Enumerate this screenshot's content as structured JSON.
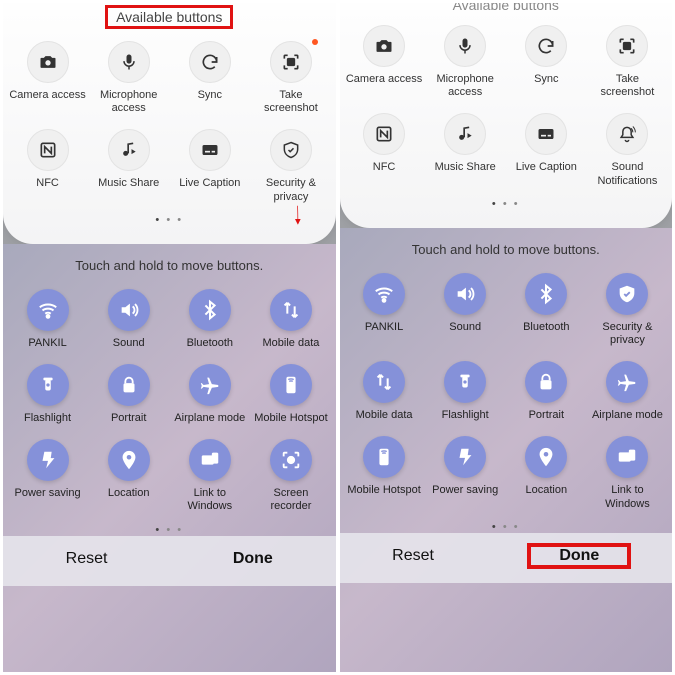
{
  "left": {
    "header": "Available buttons",
    "hint": "Touch and hold to move buttons.",
    "available": [
      {
        "label": "Camera access",
        "icon": "camera"
      },
      {
        "label": "Microphone access",
        "icon": "mic"
      },
      {
        "label": "Sync",
        "icon": "sync"
      },
      {
        "label": "Take screenshot",
        "icon": "screenshot",
        "dot": true
      },
      {
        "label": "NFC",
        "icon": "nfc"
      },
      {
        "label": "Music Share",
        "icon": "music"
      },
      {
        "label": "Live Caption",
        "icon": "caption"
      },
      {
        "label": "Security & privacy",
        "icon": "shield"
      }
    ],
    "active": [
      {
        "label": "PANKIL",
        "icon": "wifi"
      },
      {
        "label": "Sound",
        "icon": "sound"
      },
      {
        "label": "Bluetooth",
        "icon": "bt"
      },
      {
        "label": "Mobile data",
        "icon": "data"
      },
      {
        "label": "Flashlight",
        "icon": "flash"
      },
      {
        "label": "Portrait",
        "icon": "lock"
      },
      {
        "label": "Airplane mode",
        "icon": "plane"
      },
      {
        "label": "Mobile Hotspot",
        "icon": "hotspot"
      },
      {
        "label": "Power saving",
        "icon": "power"
      },
      {
        "label": "Location",
        "icon": "loc"
      },
      {
        "label": "Link to Windows",
        "icon": "link"
      },
      {
        "label": "Screen recorder",
        "icon": "rec"
      }
    ],
    "reset": "Reset",
    "done": "Done"
  },
  "right": {
    "header": "Available buttons",
    "hint": "Touch and hold to move buttons.",
    "available": [
      {
        "label": "Camera access",
        "icon": "camera"
      },
      {
        "label": "Microphone access",
        "icon": "mic"
      },
      {
        "label": "Sync",
        "icon": "sync"
      },
      {
        "label": "Take screenshot",
        "icon": "screenshot"
      },
      {
        "label": "NFC",
        "icon": "nfc"
      },
      {
        "label": "Music Share",
        "icon": "music"
      },
      {
        "label": "Live Caption",
        "icon": "caption"
      },
      {
        "label": "Sound Notifications",
        "icon": "bell"
      }
    ],
    "active": [
      {
        "label": "PANKIL",
        "icon": "wifi"
      },
      {
        "label": "Sound",
        "icon": "sound"
      },
      {
        "label": "Bluetooth",
        "icon": "bt"
      },
      {
        "label": "Security & privacy",
        "icon": "shield-f"
      },
      {
        "label": "Mobile data",
        "icon": "data"
      },
      {
        "label": "Flashlight",
        "icon": "flash"
      },
      {
        "label": "Portrait",
        "icon": "lock"
      },
      {
        "label": "Airplane mode",
        "icon": "plane"
      },
      {
        "label": "Mobile Hotspot",
        "icon": "hotspot"
      },
      {
        "label": "Power saving",
        "icon": "power"
      },
      {
        "label": "Location",
        "icon": "loc"
      },
      {
        "label": "Link to Windows",
        "icon": "link"
      }
    ],
    "reset": "Reset",
    "done": "Done"
  }
}
